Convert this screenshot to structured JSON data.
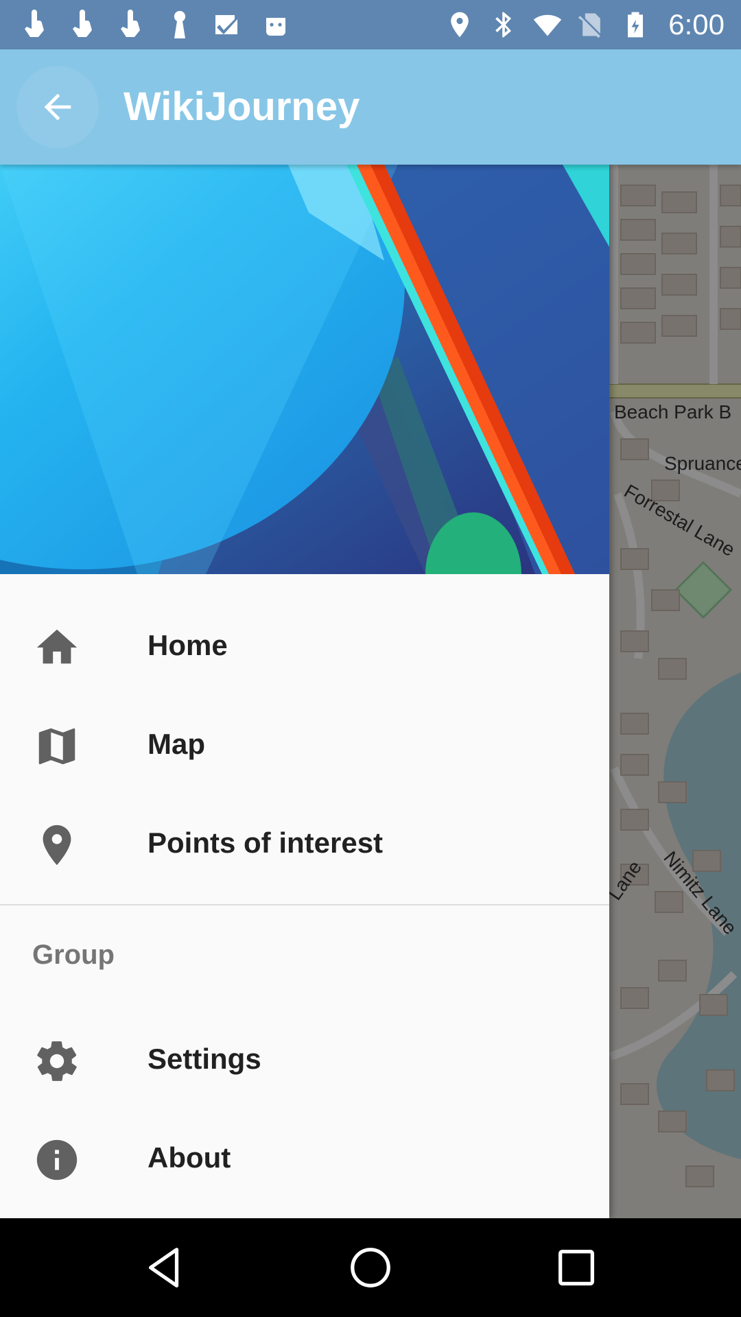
{
  "status_bar": {
    "time": "6:00",
    "left_icons": [
      "touch-icon",
      "touch-icon",
      "touch-icon",
      "keyhole-icon",
      "check-icon",
      "android-icon"
    ],
    "right_icons": [
      "location-icon",
      "bluetooth-icon",
      "wifi-icon",
      "no-sim-icon",
      "battery-icon"
    ]
  },
  "app_bar": {
    "title": "WikiJourney",
    "back_icon": "arrow-back-icon"
  },
  "drawer": {
    "items": [
      {
        "label": "Home",
        "icon": "home-icon"
      },
      {
        "label": "Map",
        "icon": "map-icon"
      },
      {
        "label": "Points of interest",
        "icon": "place-icon"
      }
    ],
    "group_title": "Group",
    "group_items": [
      {
        "label": "Settings",
        "icon": "settings-icon"
      },
      {
        "label": "About",
        "icon": "info-icon"
      }
    ]
  },
  "map": {
    "labels": [
      "Beach Park B",
      "Spruance",
      "Forrestal Lane",
      "Nimitz Lane",
      "Lane"
    ]
  },
  "colors": {
    "status_bar": "#5f86b1",
    "app_bar": "#87c6e6",
    "drawer_bg": "#fafafa",
    "icon": "#616161"
  }
}
